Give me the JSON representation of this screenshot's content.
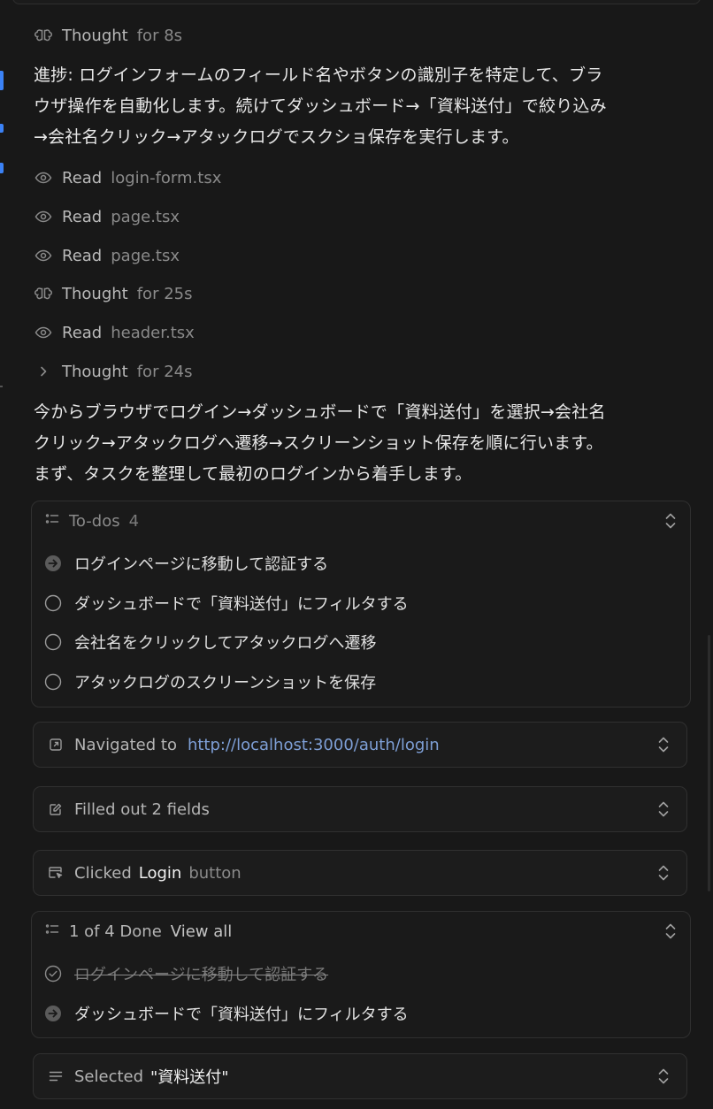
{
  "steps": [
    {
      "kind": "thought",
      "verb": "Thought",
      "detail": "for 8s",
      "icon": "brain-icon"
    },
    {
      "kind": "read",
      "verb": "Read",
      "detail": "login-form.tsx",
      "icon": "eye-icon"
    },
    {
      "kind": "read",
      "verb": "Read",
      "detail": "page.tsx",
      "icon": "eye-icon"
    },
    {
      "kind": "read",
      "verb": "Read",
      "detail": "page.tsx",
      "icon": "eye-icon"
    },
    {
      "kind": "thought",
      "verb": "Thought",
      "detail": "for 25s",
      "icon": "brain-icon"
    },
    {
      "kind": "read",
      "verb": "Read",
      "detail": "header.tsx",
      "icon": "eye-icon"
    },
    {
      "kind": "thought",
      "verb": "Thought",
      "detail": "for 24s",
      "icon": "chevron-right-icon"
    }
  ],
  "paragraphs": {
    "progress": [
      "進捗: ログインフォームのフィールド名やボタンの識別子を特定して、ブラ",
      "ウザ操作を自動化します。続けてダッシュボード→「資料送付」で絞り込み",
      "→会社名クリック→アタックログでスクショ保存を実行します。"
    ],
    "plan": [
      "今からブラウザでログイン→ダッシュボードで「資料送付」を選択→会社名",
      "クリック→アタックログへ遷移→スクリーンショット保存を順に行います。",
      "まず、タスクを整理して最初のログインから着手します。"
    ]
  },
  "todos_card": {
    "title": "To-dos",
    "count": "4",
    "items": [
      {
        "text": "ログインページに移動して認証する",
        "status": "in_progress"
      },
      {
        "text": "ダッシュボードで「資料送付」にフィルタする",
        "status": "pending"
      },
      {
        "text": "会社名をクリックしてアタックログへ遷移",
        "status": "pending"
      },
      {
        "text": "アタックログのスクリーンショットを保存",
        "status": "pending"
      }
    ]
  },
  "tools": {
    "navigate": {
      "verb": "Navigated to",
      "url": "http://localhost:3000/auth/login",
      "icon": "external-link-icon"
    },
    "fill": {
      "verb": "Filled out 2 fields",
      "icon": "edit-icon"
    },
    "click": {
      "verb": "Clicked",
      "target": "Login",
      "suffix": "button",
      "icon": "cursor-window-icon"
    },
    "select": {
      "verb": "Selected",
      "value": "\"資料送付\"",
      "icon": "lines-icon"
    }
  },
  "progress_card": {
    "title": "1 of 4 Done",
    "view_all": "View all",
    "items": [
      {
        "text": "ログインページに移動して認証する",
        "status": "done"
      },
      {
        "text": "ダッシュボードで「資料送付」にフィルタする",
        "status": "in_progress"
      }
    ]
  },
  "colors": {
    "background": "#181818",
    "link": "#7e9fd6",
    "accent_marker": "#3b82f6"
  }
}
